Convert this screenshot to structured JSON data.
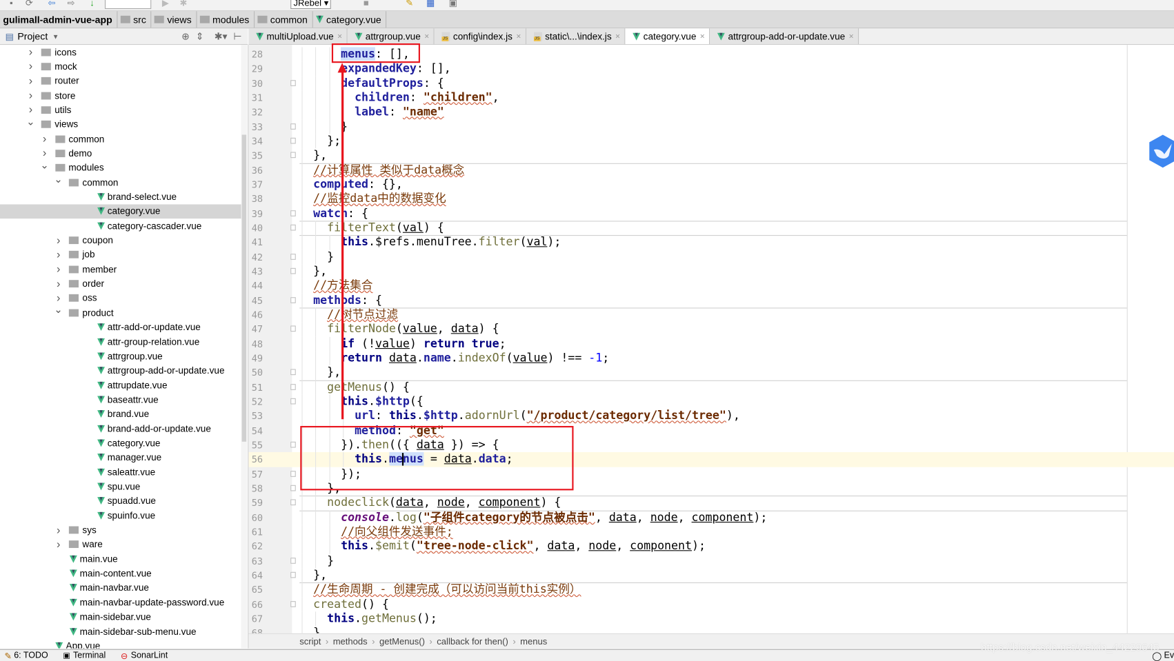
{
  "toolbar": {
    "run_config": "JRebel"
  },
  "breadcrumb": [
    "gulimall-admin-vue-app",
    "src",
    "views",
    "modules",
    "common",
    "category.vue"
  ],
  "project_panel": {
    "title": "Project"
  },
  "tree": [
    {
      "label": "icons",
      "type": "folder",
      "depth": 0,
      "state": "collapsed"
    },
    {
      "label": "mock",
      "type": "folder",
      "depth": 0,
      "state": "collapsed"
    },
    {
      "label": "router",
      "type": "folder",
      "depth": 0,
      "state": "collapsed"
    },
    {
      "label": "store",
      "type": "folder",
      "depth": 0,
      "state": "collapsed"
    },
    {
      "label": "utils",
      "type": "folder",
      "depth": 0,
      "state": "collapsed"
    },
    {
      "label": "views",
      "type": "folder",
      "depth": 0,
      "state": "expanded"
    },
    {
      "label": "common",
      "type": "folder",
      "depth": 1,
      "state": "collapsed"
    },
    {
      "label": "demo",
      "type": "folder",
      "depth": 1,
      "state": "collapsed"
    },
    {
      "label": "modules",
      "type": "folder",
      "depth": 1,
      "state": "expanded"
    },
    {
      "label": "common",
      "type": "folder",
      "depth": 2,
      "state": "expanded"
    },
    {
      "label": "brand-select.vue",
      "type": "vue",
      "depth": 3
    },
    {
      "label": "category.vue",
      "type": "vue",
      "depth": 3,
      "selected": true
    },
    {
      "label": "category-cascader.vue",
      "type": "vue",
      "depth": 3
    },
    {
      "label": "coupon",
      "type": "folder",
      "depth": 2,
      "state": "collapsed"
    },
    {
      "label": "job",
      "type": "folder",
      "depth": 2,
      "state": "collapsed"
    },
    {
      "label": "member",
      "type": "folder",
      "depth": 2,
      "state": "collapsed"
    },
    {
      "label": "order",
      "type": "folder",
      "depth": 2,
      "state": "collapsed"
    },
    {
      "label": "oss",
      "type": "folder",
      "depth": 2,
      "state": "collapsed"
    },
    {
      "label": "product",
      "type": "folder",
      "depth": 2,
      "state": "expanded"
    },
    {
      "label": "attr-add-or-update.vue",
      "type": "vue",
      "depth": 3
    },
    {
      "label": "attr-group-relation.vue",
      "type": "vue",
      "depth": 3
    },
    {
      "label": "attrgroup.vue",
      "type": "vue",
      "depth": 3
    },
    {
      "label": "attrgroup-add-or-update.vue",
      "type": "vue",
      "depth": 3
    },
    {
      "label": "attrupdate.vue",
      "type": "vue",
      "depth": 3
    },
    {
      "label": "baseattr.vue",
      "type": "vue",
      "depth": 3
    },
    {
      "label": "brand.vue",
      "type": "vue",
      "depth": 3
    },
    {
      "label": "brand-add-or-update.vue",
      "type": "vue",
      "depth": 3
    },
    {
      "label": "category.vue",
      "type": "vue",
      "depth": 3
    },
    {
      "label": "manager.vue",
      "type": "vue",
      "depth": 3
    },
    {
      "label": "saleattr.vue",
      "type": "vue",
      "depth": 3
    },
    {
      "label": "spu.vue",
      "type": "vue",
      "depth": 3
    },
    {
      "label": "spuadd.vue",
      "type": "vue",
      "depth": 3
    },
    {
      "label": "spuinfo.vue",
      "type": "vue",
      "depth": 3
    },
    {
      "label": "sys",
      "type": "folder",
      "depth": 2,
      "state": "collapsed"
    },
    {
      "label": "ware",
      "type": "folder",
      "depth": 2,
      "state": "collapsed"
    },
    {
      "label": "main.vue",
      "type": "vue",
      "depth": 1
    },
    {
      "label": "main-content.vue",
      "type": "vue",
      "depth": 1
    },
    {
      "label": "main-navbar.vue",
      "type": "vue",
      "depth": 1
    },
    {
      "label": "main-navbar-update-password.vue",
      "type": "vue",
      "depth": 1
    },
    {
      "label": "main-sidebar.vue",
      "type": "vue",
      "depth": 1
    },
    {
      "label": "main-sidebar-sub-menu.vue",
      "type": "vue",
      "depth": 1
    },
    {
      "label": "App.vue",
      "type": "vue",
      "depth": 0
    }
  ],
  "tabs": [
    {
      "label": "multiUpload.vue",
      "icon": "vue"
    },
    {
      "label": "attrgroup.vue",
      "icon": "vue"
    },
    {
      "label": "config\\index.js",
      "icon": "js"
    },
    {
      "label": "static\\...\\index.js",
      "icon": "js"
    },
    {
      "label": "category.vue",
      "icon": "vue",
      "active": true
    },
    {
      "label": "attrgroup-add-or-update.vue",
      "icon": "vue"
    }
  ],
  "editor": {
    "current_line": 56,
    "lines": [
      {
        "n": 28,
        "indent": 6,
        "tokens": [
          [
            "p h",
            "menus"
          ],
          [
            "t",
            ": [],"
          ]
        ]
      },
      {
        "n": 29,
        "indent": 6,
        "tokens": [
          [
            "p",
            "expandedKey"
          ],
          [
            "t",
            ": [],"
          ]
        ]
      },
      {
        "n": 30,
        "indent": 6,
        "fold": true,
        "tokens": [
          [
            "p",
            "defaultProps"
          ],
          [
            "t",
            ": {"
          ]
        ]
      },
      {
        "n": 31,
        "indent": 8,
        "tokens": [
          [
            "p",
            "children"
          ],
          [
            "t",
            ": "
          ],
          [
            "s",
            "\"children\""
          ],
          [
            "t",
            ","
          ]
        ]
      },
      {
        "n": 32,
        "indent": 8,
        "tokens": [
          [
            "p",
            "label"
          ],
          [
            "t",
            ": "
          ],
          [
            "s",
            "\"name\""
          ]
        ]
      },
      {
        "n": 33,
        "indent": 6,
        "fold": true,
        "tokens": [
          [
            "t",
            "}"
          ]
        ]
      },
      {
        "n": 34,
        "indent": 4,
        "fold": true,
        "tokens": [
          [
            "t",
            "};"
          ]
        ]
      },
      {
        "n": 35,
        "indent": 2,
        "fold": true,
        "sep": true,
        "tokens": [
          [
            "t",
            "},"
          ]
        ]
      },
      {
        "n": 36,
        "indent": 2,
        "tokens": [
          [
            "c",
            "//计算属性 类似于data概念"
          ]
        ]
      },
      {
        "n": 37,
        "indent": 2,
        "tokens": [
          [
            "p",
            "computed"
          ],
          [
            "t",
            ": {},"
          ]
        ]
      },
      {
        "n": 38,
        "indent": 2,
        "tokens": [
          [
            "c",
            "//监控data中的数据变化"
          ]
        ]
      },
      {
        "n": 39,
        "indent": 2,
        "fold": true,
        "sep": true,
        "tokens": [
          [
            "p",
            "watch"
          ],
          [
            "t",
            ": {"
          ]
        ]
      },
      {
        "n": 40,
        "indent": 4,
        "fold": true,
        "sep": true,
        "tokens": [
          [
            "f",
            "filterText"
          ],
          [
            "t",
            "("
          ],
          [
            "v",
            "val"
          ],
          [
            "t",
            ") {"
          ]
        ]
      },
      {
        "n": 41,
        "indent": 6,
        "tokens": [
          [
            "k",
            "this"
          ],
          [
            "t",
            ".$refs.menuTree."
          ],
          [
            "f",
            "filter"
          ],
          [
            "t",
            "("
          ],
          [
            "v",
            "val"
          ],
          [
            "t",
            ");"
          ]
        ]
      },
      {
        "n": 42,
        "indent": 4,
        "fold": true,
        "tokens": [
          [
            "t",
            "}"
          ]
        ]
      },
      {
        "n": 43,
        "indent": 2,
        "fold": true,
        "tokens": [
          [
            "t",
            "},"
          ]
        ]
      },
      {
        "n": 44,
        "indent": 2,
        "tokens": [
          [
            "c",
            "//方法集合"
          ]
        ]
      },
      {
        "n": 45,
        "indent": 2,
        "fold": true,
        "sep": true,
        "tokens": [
          [
            "p",
            "methods"
          ],
          [
            "t",
            ": {"
          ]
        ]
      },
      {
        "n": 46,
        "indent": 4,
        "tokens": [
          [
            "c",
            "//树节点过滤"
          ]
        ]
      },
      {
        "n": 47,
        "indent": 4,
        "fold": true,
        "tokens": [
          [
            "f",
            "filterNode"
          ],
          [
            "t",
            "("
          ],
          [
            "v",
            "value"
          ],
          [
            "t",
            ", "
          ],
          [
            "v",
            "data"
          ],
          [
            "t",
            ") {"
          ]
        ]
      },
      {
        "n": 48,
        "indent": 6,
        "tokens": [
          [
            "k",
            "if"
          ],
          [
            "t",
            " (!"
          ],
          [
            "v",
            "value"
          ],
          [
            "t",
            ") "
          ],
          [
            "k",
            "return true"
          ],
          [
            "t",
            ";"
          ]
        ]
      },
      {
        "n": 49,
        "indent": 6,
        "tokens": [
          [
            "k",
            "return"
          ],
          [
            "t",
            " "
          ],
          [
            "v",
            "data"
          ],
          [
            "t",
            "."
          ],
          [
            "p",
            "name"
          ],
          [
            "t",
            "."
          ],
          [
            "f",
            "indexOf"
          ],
          [
            "t",
            "("
          ],
          [
            "v",
            "value"
          ],
          [
            "t",
            ") !== "
          ],
          [
            "n",
            "-1"
          ],
          [
            "t",
            ";"
          ]
        ]
      },
      {
        "n": 50,
        "indent": 4,
        "fold": true,
        "sep": true,
        "tokens": [
          [
            "t",
            "},"
          ]
        ]
      },
      {
        "n": 51,
        "indent": 4,
        "fold": true,
        "tokens": [
          [
            "f",
            "getMenus"
          ],
          [
            "t",
            "() {"
          ]
        ]
      },
      {
        "n": 52,
        "indent": 6,
        "fold": true,
        "tokens": [
          [
            "k",
            "this"
          ],
          [
            "t",
            "."
          ],
          [
            "p",
            "$http"
          ],
          [
            "t",
            "({"
          ]
        ]
      },
      {
        "n": 53,
        "indent": 8,
        "tokens": [
          [
            "p",
            "url"
          ],
          [
            "t",
            ": "
          ],
          [
            "k",
            "this"
          ],
          [
            "t",
            "."
          ],
          [
            "p",
            "$http"
          ],
          [
            "t",
            "."
          ],
          [
            "f",
            "adornUrl"
          ],
          [
            "t",
            "("
          ],
          [
            "s",
            "\"/product/category/list/tree\""
          ],
          [
            "t",
            "),"
          ]
        ]
      },
      {
        "n": 54,
        "indent": 8,
        "tokens": [
          [
            "p",
            "method"
          ],
          [
            "t",
            ": "
          ],
          [
            "s",
            "\"get\""
          ]
        ]
      },
      {
        "n": 55,
        "indent": 6,
        "fold": true,
        "tokens": [
          [
            "t",
            "})."
          ],
          [
            "f",
            "then"
          ],
          [
            "t",
            "(({ "
          ],
          [
            "v",
            "data"
          ],
          [
            "t",
            " }) => {"
          ]
        ]
      },
      {
        "n": 56,
        "indent": 8,
        "tokens": [
          [
            "k",
            "this"
          ],
          [
            "t",
            "."
          ],
          [
            "p h",
            "menus"
          ],
          [
            "t",
            " = "
          ],
          [
            "v",
            "data"
          ],
          [
            "t",
            "."
          ],
          [
            "p",
            "data"
          ],
          [
            "t",
            ";"
          ]
        ]
      },
      {
        "n": 57,
        "indent": 6,
        "fold": true,
        "tokens": [
          [
            "t",
            "});"
          ]
        ]
      },
      {
        "n": 58,
        "indent": 4,
        "fold": true,
        "sep": true,
        "tokens": [
          [
            "t",
            "},"
          ]
        ]
      },
      {
        "n": 59,
        "indent": 4,
        "fold": true,
        "sep": true,
        "tokens": [
          [
            "f",
            "nodeclick"
          ],
          [
            "t",
            "("
          ],
          [
            "v",
            "data"
          ],
          [
            "t",
            ", "
          ],
          [
            "v",
            "node"
          ],
          [
            "t",
            ", "
          ],
          [
            "v",
            "component"
          ],
          [
            "t",
            ") {"
          ]
        ]
      },
      {
        "n": 60,
        "indent": 6,
        "tokens": [
          [
            "g",
            "console"
          ],
          [
            "t",
            "."
          ],
          [
            "f",
            "log"
          ],
          [
            "t",
            "("
          ],
          [
            "s",
            "\"子组件category的节点被点击\""
          ],
          [
            "t",
            ", "
          ],
          [
            "v",
            "data"
          ],
          [
            "t",
            ", "
          ],
          [
            "v",
            "node"
          ],
          [
            "t",
            ", "
          ],
          [
            "v",
            "component"
          ],
          [
            "t",
            ");"
          ]
        ]
      },
      {
        "n": 61,
        "indent": 6,
        "tokens": [
          [
            "c",
            "//向父组件发送事件;"
          ]
        ]
      },
      {
        "n": 62,
        "indent": 6,
        "tokens": [
          [
            "k",
            "this"
          ],
          [
            "t",
            "."
          ],
          [
            "f",
            "$emit"
          ],
          [
            "t",
            "("
          ],
          [
            "s",
            "\"tree-node-click\""
          ],
          [
            "t",
            ", "
          ],
          [
            "v",
            "data"
          ],
          [
            "t",
            ", "
          ],
          [
            "v",
            "node"
          ],
          [
            "t",
            ", "
          ],
          [
            "v",
            "component"
          ],
          [
            "t",
            ");"
          ]
        ]
      },
      {
        "n": 63,
        "indent": 4,
        "fold": true,
        "tokens": [
          [
            "t",
            "}"
          ]
        ]
      },
      {
        "n": 64,
        "indent": 2,
        "fold": true,
        "sep": true,
        "tokens": [
          [
            "t",
            "},"
          ]
        ]
      },
      {
        "n": 65,
        "indent": 2,
        "tokens": [
          [
            "c",
            "//生命周期 - 创建完成（可以访问当前this实例）"
          ]
        ]
      },
      {
        "n": 66,
        "indent": 2,
        "fold": true,
        "tokens": [
          [
            "f",
            "created"
          ],
          [
            "t",
            "() {"
          ]
        ]
      },
      {
        "n": 67,
        "indent": 4,
        "tokens": [
          [
            "k",
            "this"
          ],
          [
            "t",
            "."
          ],
          [
            "f",
            "getMenus"
          ],
          [
            "t",
            "();"
          ]
        ]
      },
      {
        "n": 68,
        "indent": 2,
        "tokens": [
          [
            "t",
            "}"
          ]
        ]
      }
    ]
  },
  "code_breadcrumb": [
    "script",
    "methods",
    "getMenus()",
    "callback for then()",
    "menus"
  ],
  "statusbar": {
    "todo": "6: TODO",
    "terminal": "Terminal",
    "sonarlint": "SonarLint",
    "event_log": "Ev"
  },
  "watermark": "https://blog.csdn.net/weixin_44229645",
  "colors": {
    "annotation_red": "#e8161f",
    "current_line": "#fffae3",
    "vue_green": "#41b883"
  }
}
